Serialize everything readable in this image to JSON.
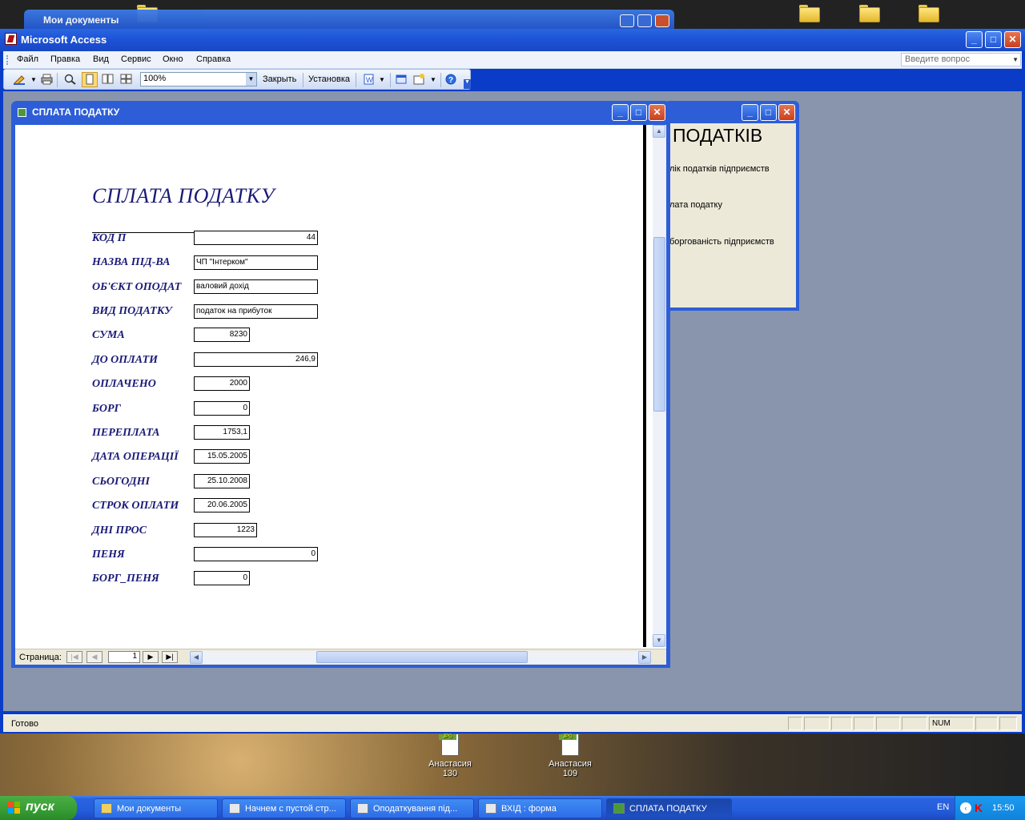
{
  "background_window": {
    "title": "Мои документы"
  },
  "access": {
    "title": "Microsoft Access",
    "menu": [
      "Файл",
      "Правка",
      "Вид",
      "Сервис",
      "Окно",
      "Справка"
    ],
    "ask_placeholder": "Введите вопрос",
    "toolbar": {
      "zoom": "100%",
      "close_label": "Закрыть",
      "setup_label": "Установка"
    },
    "status": {
      "message": "Готово",
      "num": "NUM"
    }
  },
  "menu_form": {
    "heading": "ПОДАТКІВ",
    "links": [
      "лік податків підприємств",
      "лата податку",
      "боргованість підприємств"
    ]
  },
  "report": {
    "window_title": "СПЛАТА ПОДАТКУ",
    "heading": "СПЛАТА ПОДАТКУ",
    "fields": [
      {
        "label": "КОД П",
        "value": "44"
      },
      {
        "label": "НАЗВА ПІД-ВА",
        "value": "ЧП \"Інтерком\""
      },
      {
        "label": "ОБ'ЄКТ ОПОДАТ",
        "value": "валовий дохід"
      },
      {
        "label": "ВИД ПОДАТКУ",
        "value": "податок на прибуток"
      },
      {
        "label": "СУМА",
        "value": "8230"
      },
      {
        "label": "ДО ОПЛАТИ",
        "value": "246,9"
      },
      {
        "label": "ОПЛАЧЕНО",
        "value": "2000"
      },
      {
        "label": "БОРГ",
        "value": "0"
      },
      {
        "label": "ПЕРЕПЛАТА",
        "value": "1753,1"
      },
      {
        "label": "ДАТА ОПЕРАЦІЇ",
        "value": "15.05.2005"
      },
      {
        "label": "СЬОГОДНІ",
        "value": "25.10.2008"
      },
      {
        "label": "СТРОК ОПЛАТИ",
        "value": "20.06.2005"
      },
      {
        "label": "ДНІ ПРОС",
        "value": "1223"
      },
      {
        "label": "ПЕНЯ",
        "value": "0"
      },
      {
        "label": "БОРГ_ПЕНЯ",
        "value": "0"
      }
    ],
    "nav": {
      "label": "Страница:",
      "page": "1"
    }
  },
  "desktop_icons": [
    {
      "name": "Анастасия",
      "num": "130"
    },
    {
      "name": "Анастасия",
      "num": "109"
    }
  ],
  "taskbar": {
    "start": "пуск",
    "buttons": [
      "Мои документы",
      "Начнем с пустой стр...",
      "Оподаткування під...",
      "ВХІД : форма",
      "СПЛАТА ПОДАТКУ"
    ],
    "lang": "EN",
    "clock": "15:50"
  },
  "colors": {
    "title_blue": "#1d52d6",
    "label_navy": "#1a1a78",
    "workspace": "#8895ac"
  }
}
